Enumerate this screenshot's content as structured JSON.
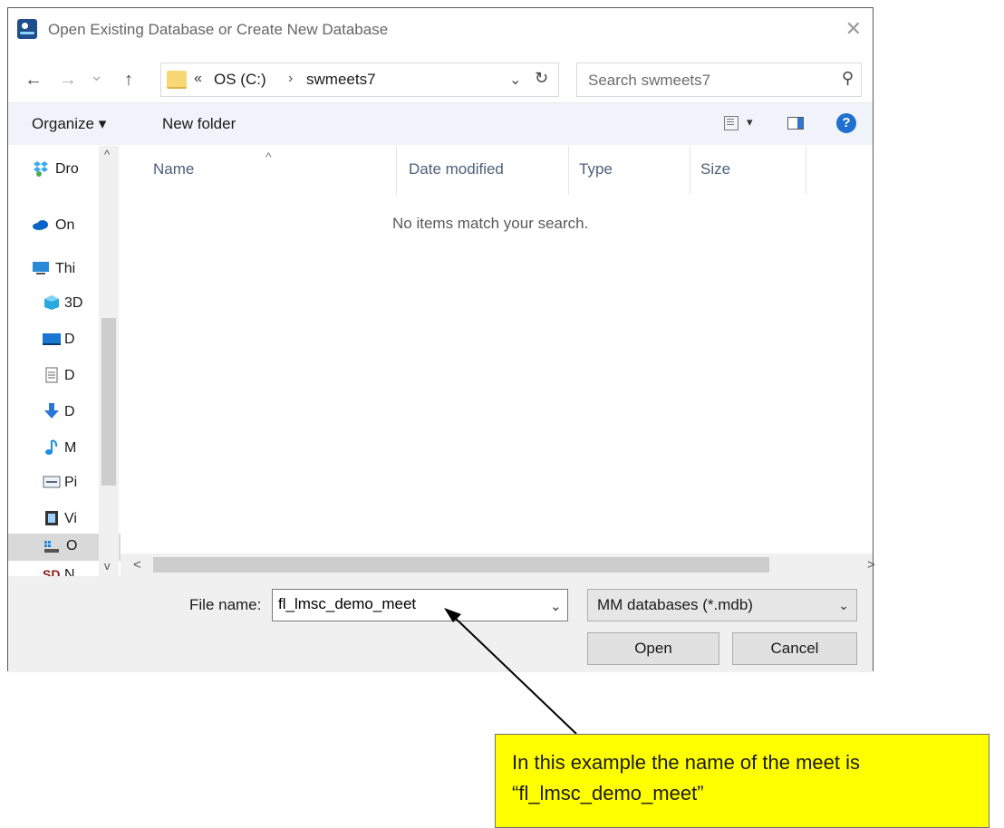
{
  "window": {
    "title": "Open Existing Database or Create New Database",
    "close_glyph": "✕"
  },
  "nav": {
    "back_glyph": "←",
    "forward_glyph": "→",
    "recent_glyph": "⌄",
    "up_glyph": "↑",
    "address_chevron": "«",
    "crumbs": [
      "OS (C:)",
      "swmeets7"
    ],
    "crumb_separator": "›",
    "address_drop_glyph": "⌄",
    "refresh_glyph": "↻",
    "search_placeholder": "Search swmeets7",
    "search_glyph": "⚲"
  },
  "toolbar": {
    "organize_label": "Organize ▾",
    "new_folder_label": "New folder",
    "view_caret": "▾",
    "help_glyph": "?"
  },
  "sidebar": {
    "items": [
      {
        "label": "Dro",
        "icon": "dropbox-icon"
      },
      {
        "label": "On",
        "icon": "onedrive-icon"
      },
      {
        "label": "Thi",
        "icon": "this-pc-icon"
      },
      {
        "label": "3D",
        "icon": "3d-objects-icon"
      },
      {
        "label": "D",
        "icon": "desktop-icon"
      },
      {
        "label": "D",
        "icon": "documents-icon"
      },
      {
        "label": "D",
        "icon": "downloads-icon"
      },
      {
        "label": "M",
        "icon": "music-icon"
      },
      {
        "label": "Pi",
        "icon": "pictures-icon"
      },
      {
        "label": "Vi",
        "icon": "videos-icon"
      },
      {
        "label": "O",
        "icon": "os-drive-icon"
      },
      {
        "label": "N",
        "icon": "sd-card-icon"
      }
    ],
    "scroll_up": "^",
    "scroll_down": "v"
  },
  "filelist": {
    "columns": [
      "Name",
      "Date modified",
      "Type",
      "Size"
    ],
    "sort_caret": "^",
    "empty_message": "No items match your search.",
    "scroll_left": "<",
    "scroll_right": ">"
  },
  "footer": {
    "file_name_label": "File name:",
    "file_name_value": "fl_lmsc_demo_meet",
    "file_name_drop": "⌄",
    "filter_value": "MM databases (*.mdb)",
    "filter_caret": "⌄",
    "open_label": "Open",
    "cancel_label": "Cancel"
  },
  "callout": {
    "line1": "In this example the name of the meet is",
    "line2": "“fl_lmsc_demo_meet”"
  },
  "colors": {
    "callout_bg": "#ffff00",
    "help_blue": "#1f6fd1",
    "folder_yellow": "#f8d775"
  }
}
